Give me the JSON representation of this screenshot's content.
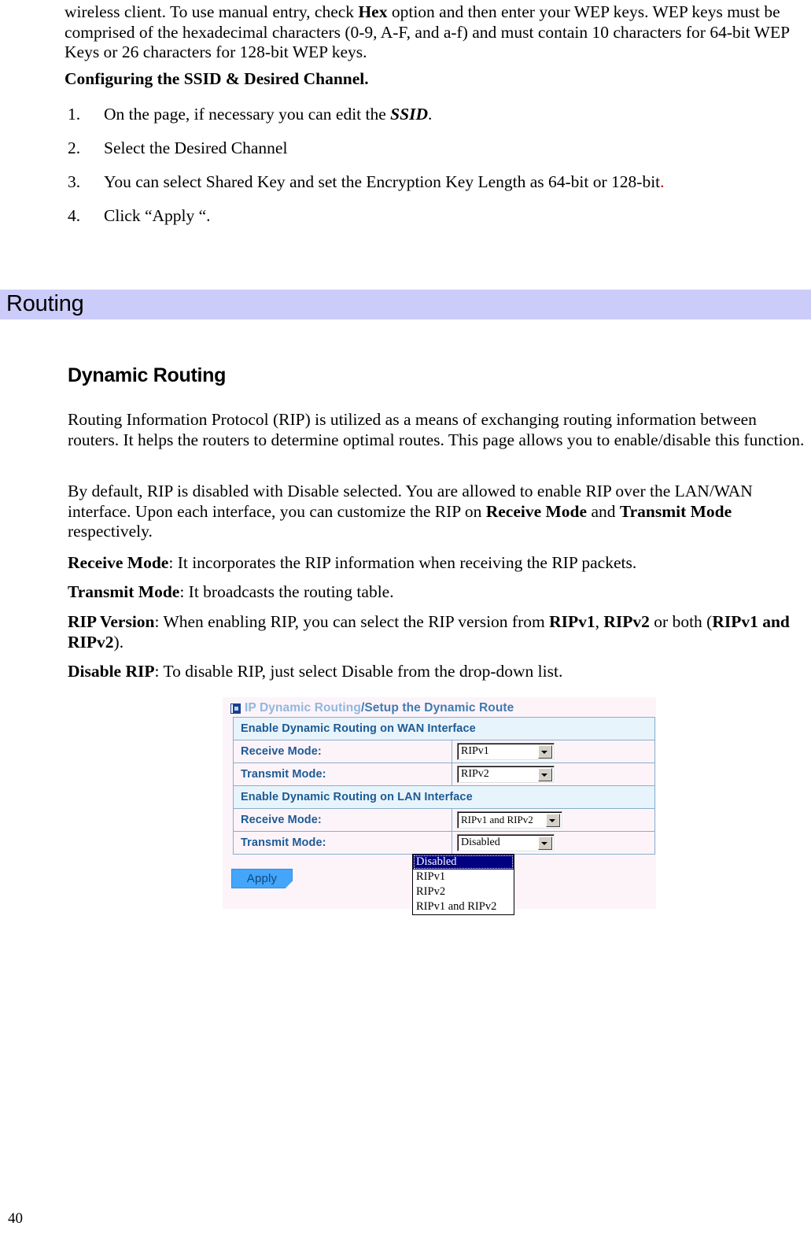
{
  "document": {
    "page_number": "40"
  },
  "intro": {
    "paragraph": "wireless client. To use manual entry, check ",
    "bold_hex": "Hex",
    "paragraph_rest": " option and then enter your WEP keys. WEP keys must be comprised of the hexadecimal characters (0-9, A-F, and a-f) and must contain 10 characters for 64-bit WEP Keys or 26 characters for 128-bit WEP keys."
  },
  "configuring": {
    "heading": "Configuring the SSID & Desired Channel.",
    "steps": [
      {
        "num": "1.",
        "pre": "On the page, if necessary you can edit the ",
        "em": "SSID",
        "post": "."
      },
      {
        "num": "2.",
        "pre": "Select the Desired Channel",
        "em": "",
        "post": ""
      },
      {
        "num": "3.",
        "pre": "You can select Shared Key and set the Encryption Key Length as 64-bit or 128-bit",
        "em": "",
        "post": "."
      },
      {
        "num": "4.",
        "pre": "Click “Apply “.",
        "em": "",
        "post": ""
      }
    ]
  },
  "chapter": {
    "title": "Routing",
    "bar_color": "#ccccfa"
  },
  "section": {
    "heading": "Dynamic Routing",
    "paragraphs": [
      {
        "id": "p1",
        "text": "Routing Information Protocol (RIP) is utilized as a means of exchanging routing information between routers. It helps the routers to determine optimal routes. This page allows you to enable/disable this function."
      },
      {
        "id": "p2",
        "pre": "By default, RIP is disabled with Disable selected. You are allowed to enable RIP over the LAN/WAN interface. Upon each interface, you can customize the RIP on ",
        "b1": "Receive Mode",
        "mid": " and ",
        "b2": "Transmit Mode",
        "post": " respectively."
      }
    ],
    "definitions": [
      {
        "term": "Receive Mode",
        "text": ": It incorporates the RIP information when receiving the RIP packets."
      },
      {
        "term": "Transmit Mode",
        "text": ": It broadcasts the routing table."
      },
      {
        "term": "RIP Version",
        "text_pre": ": When enabling RIP, you can select the RIP version from ",
        "b1": "RIPv1",
        "sep": ", ",
        "b2": "RIPv2",
        "mid": " or both (",
        "b3": "RIPv1 and RIPv2",
        "post": ")."
      },
      {
        "term": "Disable RIP",
        "text": ": To disable RIP, just select Disable from the drop-down list."
      }
    ]
  },
  "router_ui": {
    "title_primary": "IP Dynamic Routing",
    "title_separator": " / ",
    "title_secondary": "Setup the Dynamic Route",
    "title_icon": "page-icon",
    "rows": [
      {
        "type": "header",
        "label": "Enable Dynamic Routing on WAN Interface"
      },
      {
        "type": "field",
        "label": "Receive Mode:",
        "value": "RIPv1",
        "wide": false
      },
      {
        "type": "field",
        "label": "Transmit Mode:",
        "value": "RIPv2",
        "wide": false
      },
      {
        "type": "header",
        "label": "Enable Dynamic Routing on LAN Interface"
      },
      {
        "type": "field",
        "label": "Receive Mode:",
        "value": "RIPv1 and RIPv2",
        "wide": true
      },
      {
        "type": "field",
        "label": "Transmit Mode:",
        "value": "Disabled",
        "wide": false
      }
    ],
    "open_dropdown": {
      "options": [
        "Disabled",
        "RIPv1",
        "RIPv2",
        "RIPv1 and RIPv2"
      ],
      "selected_index": 0,
      "highlight_color": "#000080"
    },
    "apply_label": "Apply",
    "panel_bg": "#fdf4fa",
    "header_bg": "#e8f4fb",
    "header_text_color": "#1d5a94",
    "border_color": "#8aaecb"
  }
}
